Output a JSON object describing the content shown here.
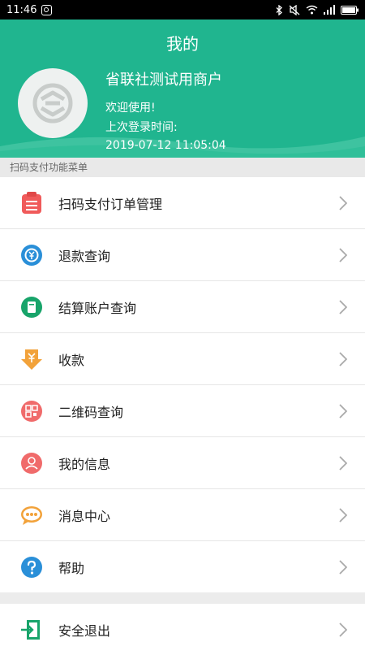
{
  "status": {
    "time": "11:46"
  },
  "header": {
    "title": "我的",
    "merchant_name": "省联社测试用商户",
    "welcome": "欢迎使用!",
    "last_login_label": "上次登录时间:",
    "last_login_time": "2019-07-12 11:05:04"
  },
  "section_label": "扫码支付功能菜单",
  "menu": [
    {
      "label": "扫码支付订单管理",
      "icon": "order-list-icon"
    },
    {
      "label": "退款查询",
      "icon": "refund-icon"
    },
    {
      "label": "结算账户查询",
      "icon": "settlement-account-icon"
    },
    {
      "label": "收款",
      "icon": "collect-money-icon"
    },
    {
      "label": "二维码查询",
      "icon": "qrcode-icon"
    },
    {
      "label": "我的信息",
      "icon": "user-info-icon"
    },
    {
      "label": "消息中心",
      "icon": "message-center-icon"
    },
    {
      "label": "帮助",
      "icon": "help-icon"
    }
  ],
  "logout": {
    "label": "安全退出",
    "icon": "logout-icon"
  },
  "colors": {
    "primary": "#20b58f",
    "order_icon": "#f05a5a",
    "refund_icon": "#2a8fd8",
    "account_icon": "#18a46a",
    "collect_icon": "#f2a23a",
    "qrcode_icon": "#f06b6b",
    "help_icon": "#2a8fd8"
  }
}
